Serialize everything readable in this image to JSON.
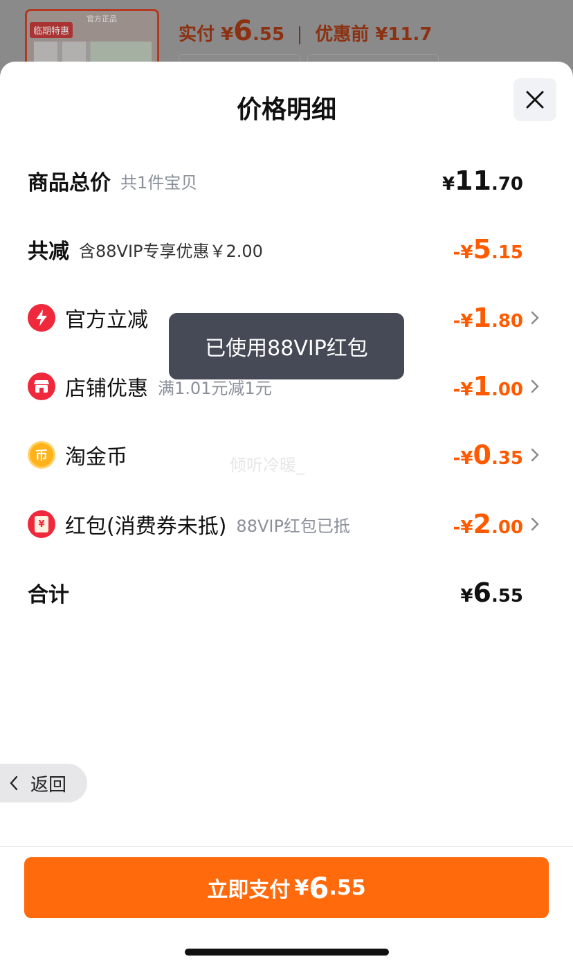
{
  "background": {
    "thumb_brand": "官方正品",
    "thumb_tag": "临期特惠",
    "price_label": "实付",
    "price_symbol": "¥",
    "price_big": "6",
    "price_small": ".55",
    "before_label": "优惠前 ¥11.7"
  },
  "sheet": {
    "title": "价格明细"
  },
  "rows": {
    "total": {
      "label": "商品总价",
      "sub": "共1件宝贝",
      "sym": "¥",
      "big": "11",
      "small": ".70"
    },
    "reduce": {
      "label": "共减",
      "sub": "含88VIP专享优惠￥2.00",
      "prefix": "-¥",
      "big": "5",
      "small": ".15"
    },
    "official": {
      "label": "官方立减",
      "prefix": "-¥",
      "big": "1",
      "small": ".80",
      "icon": "lightning-icon"
    },
    "shop": {
      "label": "店铺优惠",
      "sub": "满1.01元减1元",
      "prefix": "-¥",
      "big": "1",
      "small": ".00",
      "icon": "shop-icon"
    },
    "coin": {
      "label": "淘金币",
      "prefix": "-¥",
      "big": "0",
      "small": ".35",
      "icon": "coin-icon",
      "icon_text": "币"
    },
    "redpack": {
      "label": "红包(消费券未抵)",
      "sub": "88VIP红包已抵",
      "prefix": "-¥",
      "big": "2",
      "small": ".00",
      "icon": "red-envelope-icon",
      "icon_text": "¥"
    },
    "sum": {
      "label": "合计",
      "sym": "¥",
      "big": "6",
      "small": ".55"
    }
  },
  "toast": "已使用88VIP红包",
  "watermark": "倾听冷暖_",
  "back": "返回",
  "pay_button": {
    "text": "立即支付",
    "sym": "¥",
    "big": "6",
    "small": ".55"
  },
  "colors": {
    "accent": "#ff6a0c",
    "discount": "#ff5a00",
    "toast_bg": "#454a56"
  }
}
